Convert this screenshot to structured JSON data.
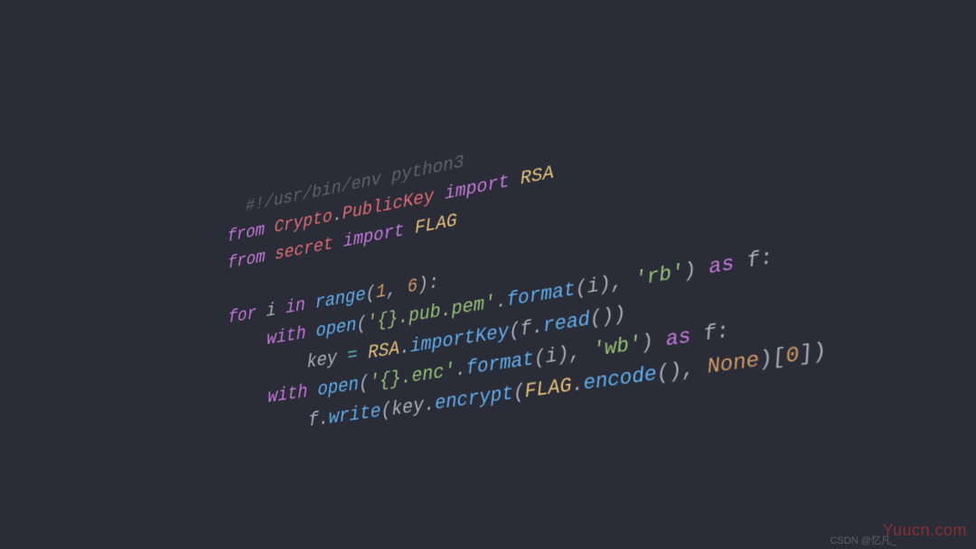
{
  "code": {
    "shebang": "#!/usr/bin/env python3",
    "line1": {
      "from": "from",
      "mod1": "Crypto",
      "dot": ".",
      "mod2": "PublicKey",
      "import": "import",
      "name": "RSA"
    },
    "line2": {
      "from": "from",
      "mod": "secret",
      "import": "import",
      "name": "FLAG"
    },
    "line3": {
      "for": "for",
      "var": "i",
      "in": "in",
      "fn": "range",
      "lp": "(",
      "n1": "1",
      "comma": ", ",
      "n2": "6",
      "rp": ")",
      "colon": ":"
    },
    "line4": {
      "with": "with",
      "open": "open",
      "lp": "(",
      "s1": "'{}.pub.pem'",
      "dot": ".",
      "format": "format",
      "lp2": "(",
      "arg": "i",
      "rp2": ")",
      "comma": ", ",
      "s2": "'rb'",
      "rp": ")",
      "as": "as",
      "f": "f",
      "colon": ":"
    },
    "line5": {
      "var": "key",
      "eq": " = ",
      "cls": "RSA",
      "dot": ".",
      "fn": "importKey",
      "lp": "(",
      "arg1": "f",
      "dot2": ".",
      "fn2": "read",
      "lp2": "(",
      "rp2": ")",
      "rp": ")"
    },
    "line6": {
      "with": "with",
      "open": "open",
      "lp": "(",
      "s1": "'{}.enc'",
      "dot": ".",
      "format": "format",
      "lp2": "(",
      "arg": "i",
      "rp2": ")",
      "comma": ", ",
      "s2": "'wb'",
      "rp": ")",
      "as": "as",
      "f": "f",
      "colon": ":"
    },
    "line7": {
      "obj": "f",
      "dot": ".",
      "fn": "write",
      "lp": "(",
      "obj2": "key",
      "dot2": ".",
      "fn2": "encrypt",
      "lp2": "(",
      "obj3": "FLAG",
      "dot3": ".",
      "fn3": "encode",
      "lp3": "(",
      "rp3": ")",
      "comma": ", ",
      "none": "None",
      "rp2": ")",
      "idx": "[",
      "n": "0",
      "idx2": "]",
      "rp": ")"
    }
  },
  "watermarks": {
    "right": "Yuucn.com",
    "center": "CSDN @忆凡_"
  }
}
